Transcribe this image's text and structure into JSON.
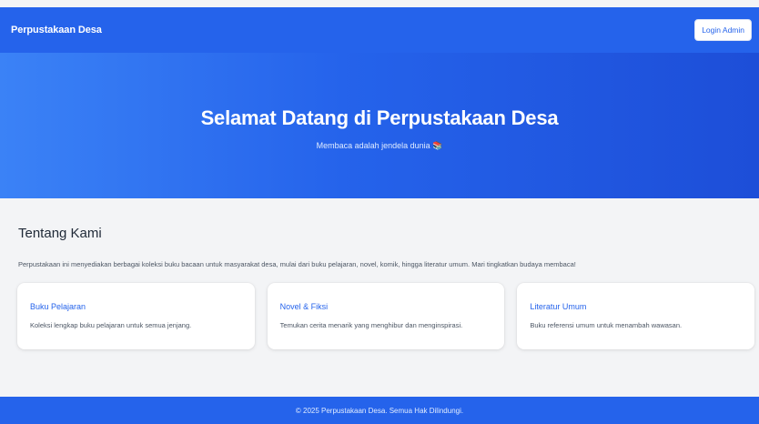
{
  "navbar": {
    "brand": "Perpustakaan Desa",
    "login_label": "Login Admin"
  },
  "hero": {
    "title": "Selamat Datang di Perpustakaan Desa",
    "subtitle": "Membaca adalah jendela dunia 📚"
  },
  "about": {
    "heading": "Tentang Kami",
    "text": "Perpustakaan ini menyediakan berbagai koleksi buku bacaan untuk masyarakat desa, mulai dari buku pelajaran, novel, komik, hingga literatur umum. Mari tingkatkan budaya membaca!"
  },
  "cards": [
    {
      "title": "Buku Pelajaran",
      "description": "Koleksi lengkap buku pelajaran untuk semua jenjang."
    },
    {
      "title": "Novel & Fiksi",
      "description": "Temukan cerita menarik yang menghibur dan menginspirasi."
    },
    {
      "title": "Literatur Umum",
      "description": "Buku referensi umum untuk menambah wawasan."
    }
  ],
  "footer": {
    "text": "© 2025 Perpustakaan Desa. Semua Hak Dilindungi."
  },
  "colors": {
    "primary": "#2563eb",
    "background": "#f3f4f6"
  }
}
